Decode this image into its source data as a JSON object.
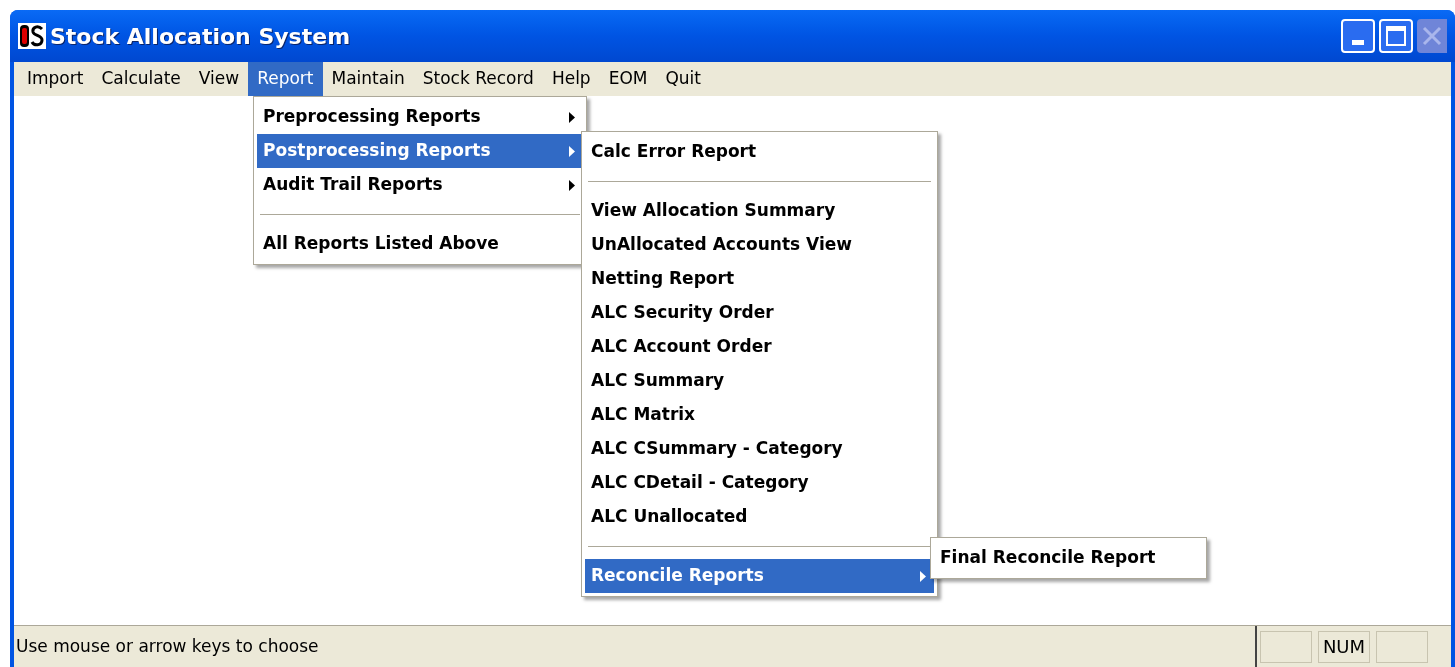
{
  "window": {
    "title": "Stock Allocation System"
  },
  "menu_bar": [
    {
      "label": "Import",
      "selected": false
    },
    {
      "label": "Calculate",
      "selected": false
    },
    {
      "label": "View",
      "selected": false
    },
    {
      "label": "Report",
      "selected": true
    },
    {
      "label": "Maintain",
      "selected": false
    },
    {
      "label": "Stock Record",
      "selected": false
    },
    {
      "label": "Help",
      "selected": false
    },
    {
      "label": "EOM",
      "selected": false
    },
    {
      "label": "Quit",
      "selected": false
    }
  ],
  "report_menu": [
    {
      "kind": "submenu",
      "label": "Preprocessing Reports",
      "selected": false
    },
    {
      "kind": "submenu",
      "label": "Postprocessing Reports",
      "selected": true
    },
    {
      "kind": "submenu",
      "label": "Audit Trail Reports",
      "selected": false
    },
    {
      "kind": "separator"
    },
    {
      "kind": "item",
      "label": "All Reports Listed Above",
      "selected": false
    }
  ],
  "postprocessing_menu": [
    {
      "kind": "item",
      "label": "Calc Error Report",
      "selected": false
    },
    {
      "kind": "separator"
    },
    {
      "kind": "item",
      "label": "View Allocation Summary",
      "selected": false
    },
    {
      "kind": "item",
      "label": "UnAllocated Accounts View",
      "selected": false
    },
    {
      "kind": "item",
      "label": "Netting Report",
      "selected": false
    },
    {
      "kind": "item",
      "label": "ALC Security Order",
      "selected": false
    },
    {
      "kind": "item",
      "label": "ALC Account Order",
      "selected": false
    },
    {
      "kind": "item",
      "label": "ALC Summary",
      "selected": false
    },
    {
      "kind": "item",
      "label": "ALC Matrix",
      "selected": false
    },
    {
      "kind": "item",
      "label": "ALC CSummary - Category",
      "selected": false
    },
    {
      "kind": "item",
      "label": "ALC CDetail - Category",
      "selected": false
    },
    {
      "kind": "item",
      "label": "ALC Unallocated",
      "selected": false
    },
    {
      "kind": "separator"
    },
    {
      "kind": "submenu",
      "label": "Reconcile Reports",
      "selected": true
    }
  ],
  "reconcile_menu": [
    {
      "kind": "item",
      "label": "Final Reconcile Report",
      "selected": false
    }
  ],
  "status_bar": {
    "message": "Use mouse or arrow keys to choose",
    "num_indicator": "NUM"
  }
}
